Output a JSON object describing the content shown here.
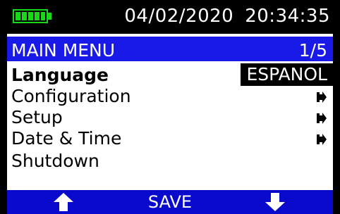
{
  "status_bar": {
    "date": "04/02/2020",
    "time": "20:34:35",
    "battery_level": 1.0,
    "battery_color": "#18d818"
  },
  "menu": {
    "title": "MAIN MENU",
    "page": "1/5",
    "header_color": "#1a1ae8",
    "items": [
      {
        "label": "Language",
        "value": "ESPANOL",
        "selected": true
      },
      {
        "label": "Configuration",
        "icon": "submenu-arrow-icon"
      },
      {
        "label": "Setup",
        "icon": "submenu-arrow-icon"
      },
      {
        "label": "Date & Time",
        "icon": "submenu-arrow-icon"
      },
      {
        "label": "Shutdown"
      }
    ]
  },
  "softkeys": {
    "left_icon": "arrow-up-icon",
    "center_label": "SAVE",
    "right_icon": "arrow-down-icon",
    "bar_color": "#0a0acc"
  }
}
